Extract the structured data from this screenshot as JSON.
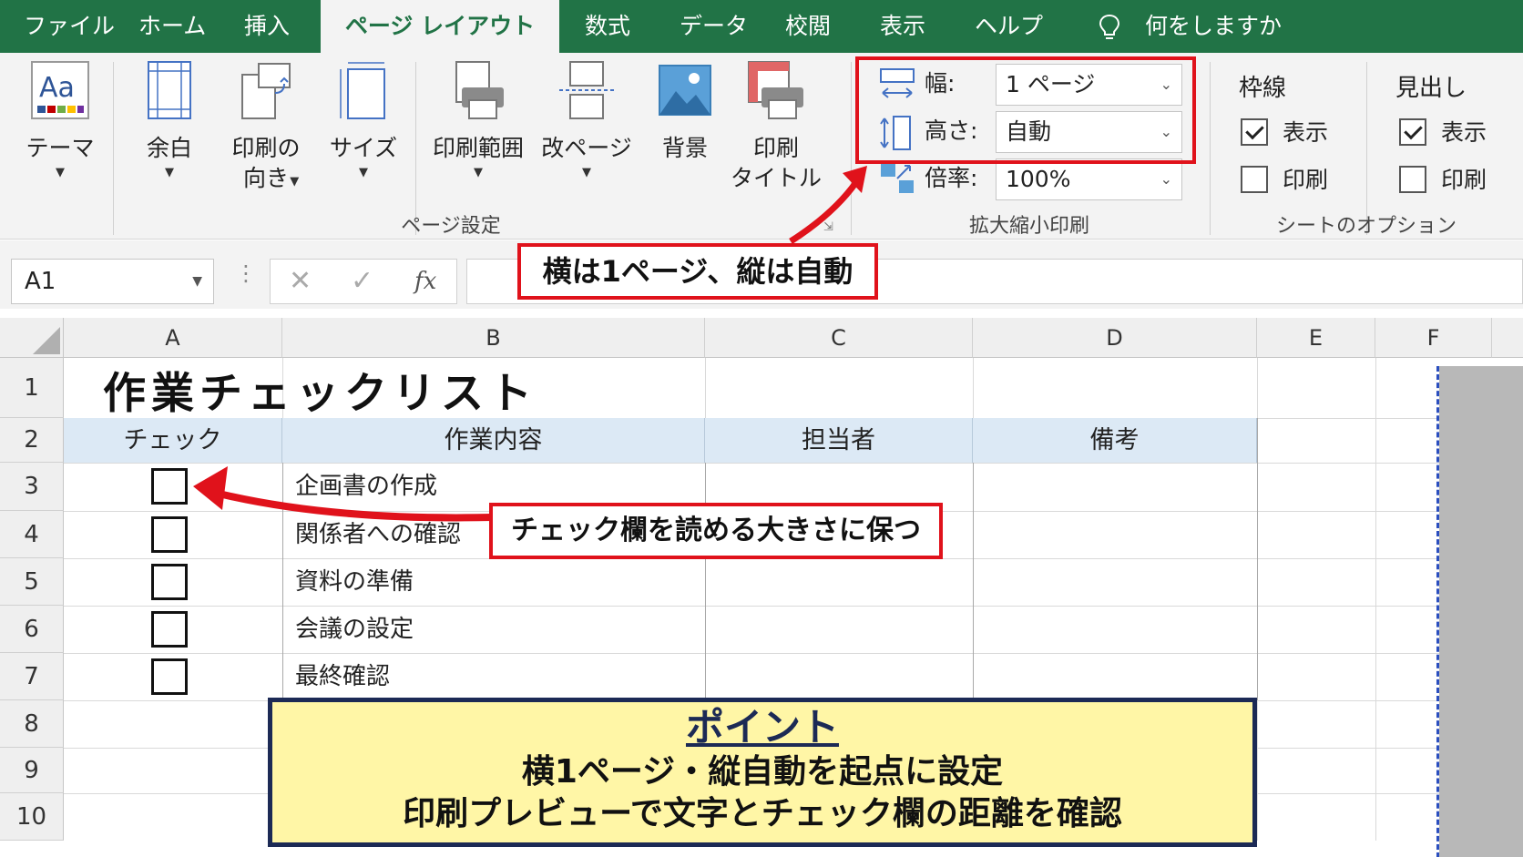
{
  "tabs": [
    "ファイル",
    "ホーム",
    "挿入",
    "ページ レイアウト",
    "数式",
    "データ",
    "校閲",
    "表示",
    "ヘルプ"
  ],
  "active_tab": "ページ レイアウト",
  "tell_me": "何をしますか",
  "ribbon": {
    "theme": {
      "label": "テーマ",
      "icon": "theme-icon"
    },
    "page_setup": {
      "buttons": [
        {
          "label": "余白",
          "icon": "margins-icon"
        },
        {
          "label": "印刷の\n向き",
          "icon": "orientation-icon"
        },
        {
          "label": "サイズ",
          "icon": "size-icon"
        },
        {
          "label": "印刷範囲",
          "icon": "print-area-icon"
        },
        {
          "label": "改ページ",
          "icon": "breaks-icon"
        },
        {
          "label": "背景",
          "icon": "background-icon"
        },
        {
          "label": "印刷\nタイトル",
          "icon": "print-titles-icon"
        }
      ],
      "group_label": "ページ設定"
    },
    "scale_to_fit": {
      "width_label": "幅:",
      "width_value": "1 ページ",
      "height_label": "高さ:",
      "height_value": "自動",
      "scale_label": "倍率:",
      "scale_value": "100%",
      "group_label": "拡大縮小印刷"
    },
    "sheet_options": {
      "gridlines": {
        "title": "枠線",
        "view_label": "表示",
        "view_checked": true,
        "print_label": "印刷",
        "print_checked": false
      },
      "headings": {
        "title": "見出し",
        "view_label": "表示",
        "view_checked": true,
        "print_label": "印刷",
        "print_checked": false
      },
      "group_label": "シートのオプション"
    }
  },
  "formula_bar": {
    "name_box": "A1",
    "cancel": "✕",
    "enter": "✓",
    "fx": "fx",
    "content": ""
  },
  "sheet": {
    "columns": [
      "A",
      "B",
      "C",
      "D",
      "E",
      "F"
    ],
    "rows": [
      "1",
      "2",
      "3",
      "4",
      "5",
      "6",
      "7",
      "8",
      "9",
      "10"
    ],
    "title": "作業チェックリスト",
    "headers": [
      "チェック",
      "作業内容",
      "担当者",
      "備考"
    ],
    "tasks": [
      "企画書の作成",
      "関係者への確認",
      "資料の準備",
      "会議の設定",
      "最終確認"
    ]
  },
  "annotations": {
    "scale_callout": "横は1ページ、縦は自動",
    "checkbox_callout": "チェック欄を読める大きさに保つ",
    "point_heading": "ポイント",
    "point_line1": "横1ページ・縦自動を起点に設定",
    "point_line2": "印刷プレビューで文字とチェック欄の距離を確認",
    "accent_color": "#e0121b"
  },
  "colors": {
    "excel_green": "#217346",
    "header_fill": "#dce9f5",
    "point_fill": "#fff6a6",
    "point_border": "#1c2a55"
  }
}
